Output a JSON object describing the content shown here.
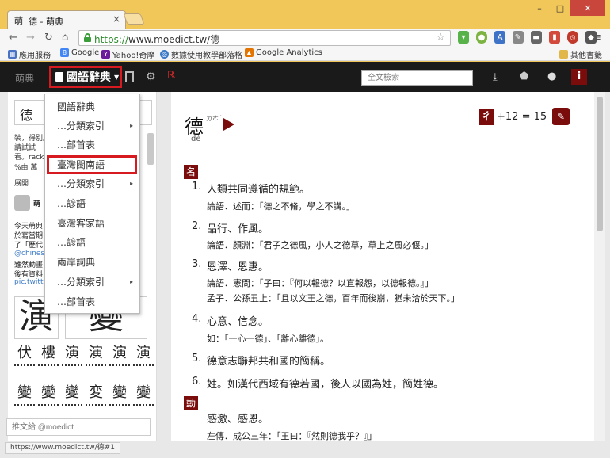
{
  "browser": {
    "tab_title": "德 - 萌典",
    "tab_favicon": "萌",
    "url_proto": "https://",
    "url_rest": "www.moedict.tw/德",
    "bookmarks": [
      "應用服務",
      "Google",
      "Yahoo!奇摩",
      "數據使用教學部落格",
      "Google Analytics"
    ],
    "other_bookmarks": "其他書籤"
  },
  "navbar": {
    "logo": "萌典",
    "dict_label": "國語辭典",
    "search_placeholder": "全文檢索"
  },
  "sidebar": {
    "search_value": "德",
    "lines": [
      "裝，得別原",
      "請試試",
      "看。rackl",
      "%由 萬",
      "展開"
    ],
    "tweet": {
      "name": "萌",
      "lines": [
        "今天萌典",
        "於寫當期",
        "了「歷代",
        "@chinese",
        "雖然動畫",
        "後有資料",
        "pic.twitte"
      ]
    },
    "big_chars": [
      "演",
      "變"
    ],
    "small_row1": [
      "伏",
      "樓",
      "演",
      "演",
      "演",
      "演"
    ],
    "small_row2": [
      "變",
      "變",
      "變",
      "変",
      "變",
      "變"
    ],
    "tweet_placeholder": "推文給 @moedict"
  },
  "dropdown": {
    "items": [
      {
        "label": "國語辭典",
        "arrow": ""
      },
      {
        "label": "…分類索引",
        "arrow": "▸"
      },
      {
        "label": "…部首表",
        "arrow": ""
      },
      {
        "label": "臺灣閩南語",
        "arrow": ""
      },
      {
        "label": "…分類索引",
        "arrow": "▸"
      },
      {
        "label": "…諺語",
        "arrow": ""
      },
      {
        "label": "臺灣客家語",
        "arrow": ""
      },
      {
        "label": "…諺語",
        "arrow": ""
      },
      {
        "label": "兩岸詞典",
        "arrow": ""
      },
      {
        "label": "…分類索引",
        "arrow": "▸"
      },
      {
        "label": "…部首表",
        "arrow": ""
      }
    ]
  },
  "entry": {
    "headword": "德",
    "zhuyin": "ㄉㄜˊ",
    "pinyin": "dé",
    "radical": "彳",
    "stroke_info": "+12 = 15",
    "pos1": "名",
    "pos2": "動",
    "definitions": [
      {
        "num": "1.",
        "text": "人類共同遵循的規範。",
        "examples": [
          "論語．述而：「德之不脩，學之不講。」"
        ]
      },
      {
        "num": "2.",
        "text": "品行、作風。",
        "examples": [
          "論語．顏淵：「君子之德風，小人之德草，草上之風必偃。」"
        ]
      },
      {
        "num": "3.",
        "text": "恩澤、恩惠。",
        "examples": [
          "論語．憲問：「子曰：『何以報德？以直報怨，以德報德。』」",
          "孟子．公孫丑上：「且以文王之德，百年而後崩，猶未洽於天下。」"
        ]
      },
      {
        "num": "4.",
        "text": "心意、信念。",
        "examples": [
          "如：「一心一德」、「離心離德」。"
        ]
      },
      {
        "num": "5.",
        "text": "德意志聯邦共和國的簡稱。",
        "examples": []
      },
      {
        "num": "6.",
        "text": "姓。如漢代西域有德若國，後人以國為姓，簡姓德。",
        "examples": []
      }
    ],
    "verb_def": "感激、感恩。",
    "verb_examples": [
      "左傳．成公三年：「王曰：『然則德我乎？』」"
    ]
  },
  "status": "https://www.moedict.tw/德#1"
}
